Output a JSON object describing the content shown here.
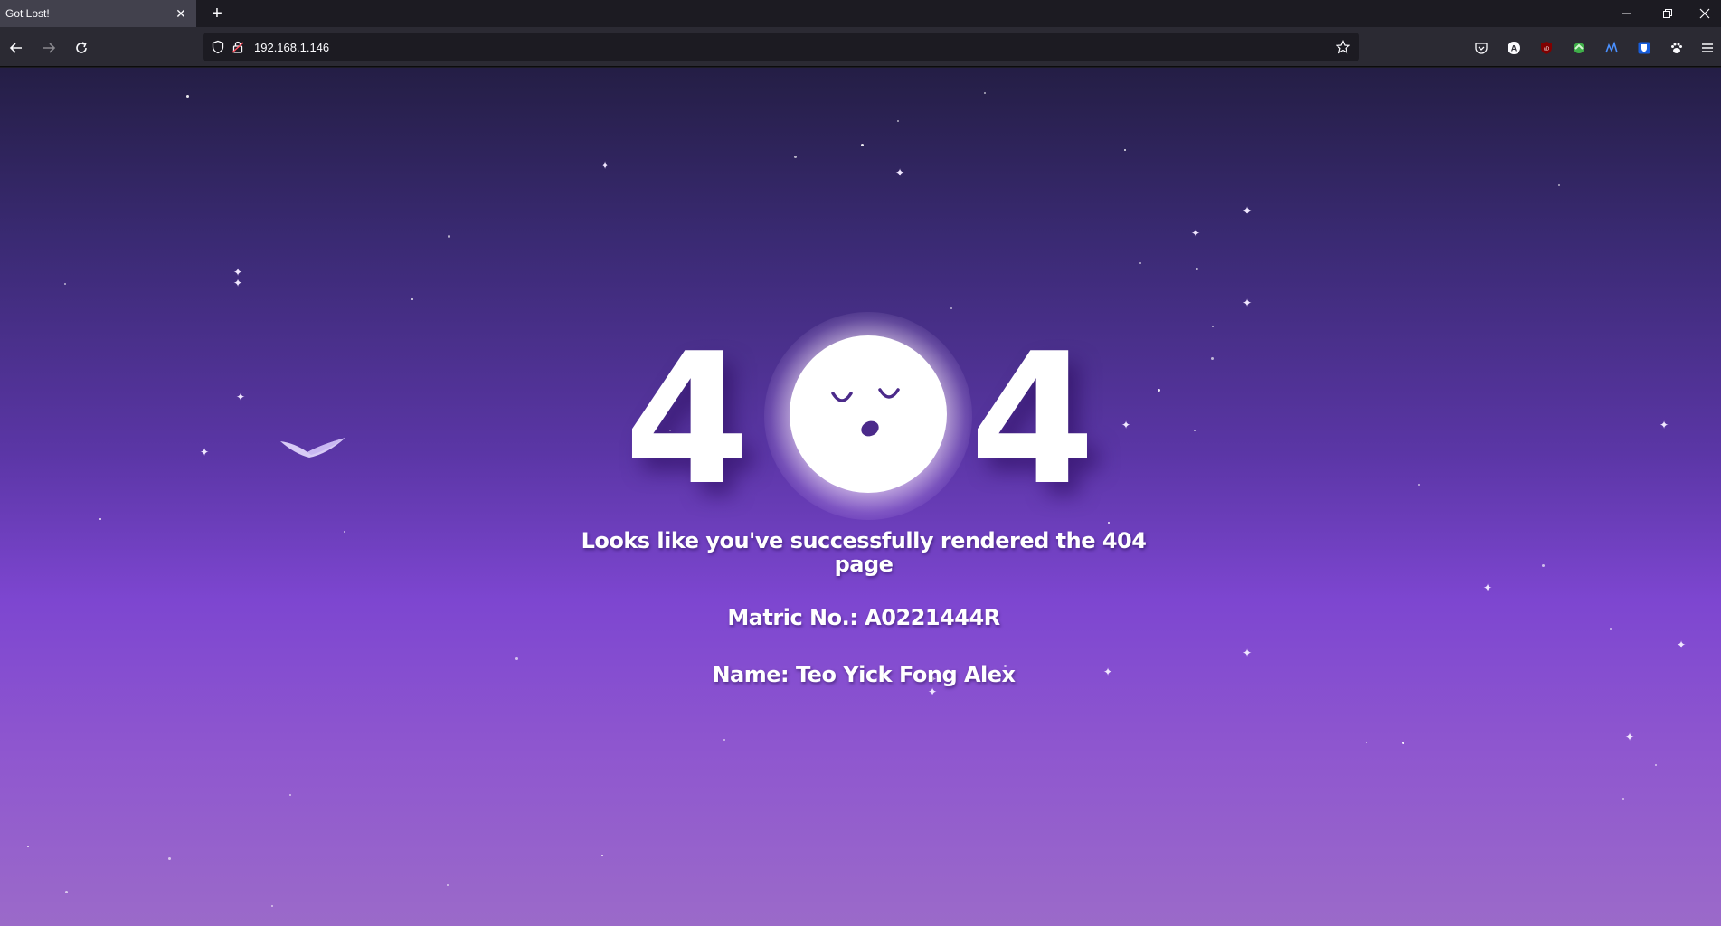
{
  "browser": {
    "tab_title": "Got Lost!",
    "tab_close": "✕",
    "new_tab": "+",
    "url": "192.168.1.146",
    "window_controls": [
      "minimize-icon",
      "restore-icon",
      "close-icon"
    ],
    "nav_icons": [
      "back-arrow-icon",
      "forward-arrow-icon",
      "reload-icon"
    ],
    "extension_icons": [
      "pocket-icon",
      "account-icon",
      "ublock-icon",
      "extension-green-icon",
      "extension-blue-icon",
      "bitwarden-icon",
      "paw-icon",
      "menu-icon"
    ]
  },
  "page": {
    "digit_left": "4",
    "digit_right": "4",
    "moon_icon": "sleeping-moon-icon",
    "bird_icon": "bird-icon",
    "message_line1": "Looks like you've successfully rendered the 404",
    "message_line2": "page",
    "matric": "Matric No.: A0221444R",
    "name": "Name: Teo Yick Fong Alex"
  },
  "colors": {
    "gradient_top": "#241e45",
    "gradient_mid": "#7d46d0",
    "gradient_bottom": "#9b6ac9",
    "text": "#ffffff",
    "moon_face": "#4b2a8a"
  }
}
